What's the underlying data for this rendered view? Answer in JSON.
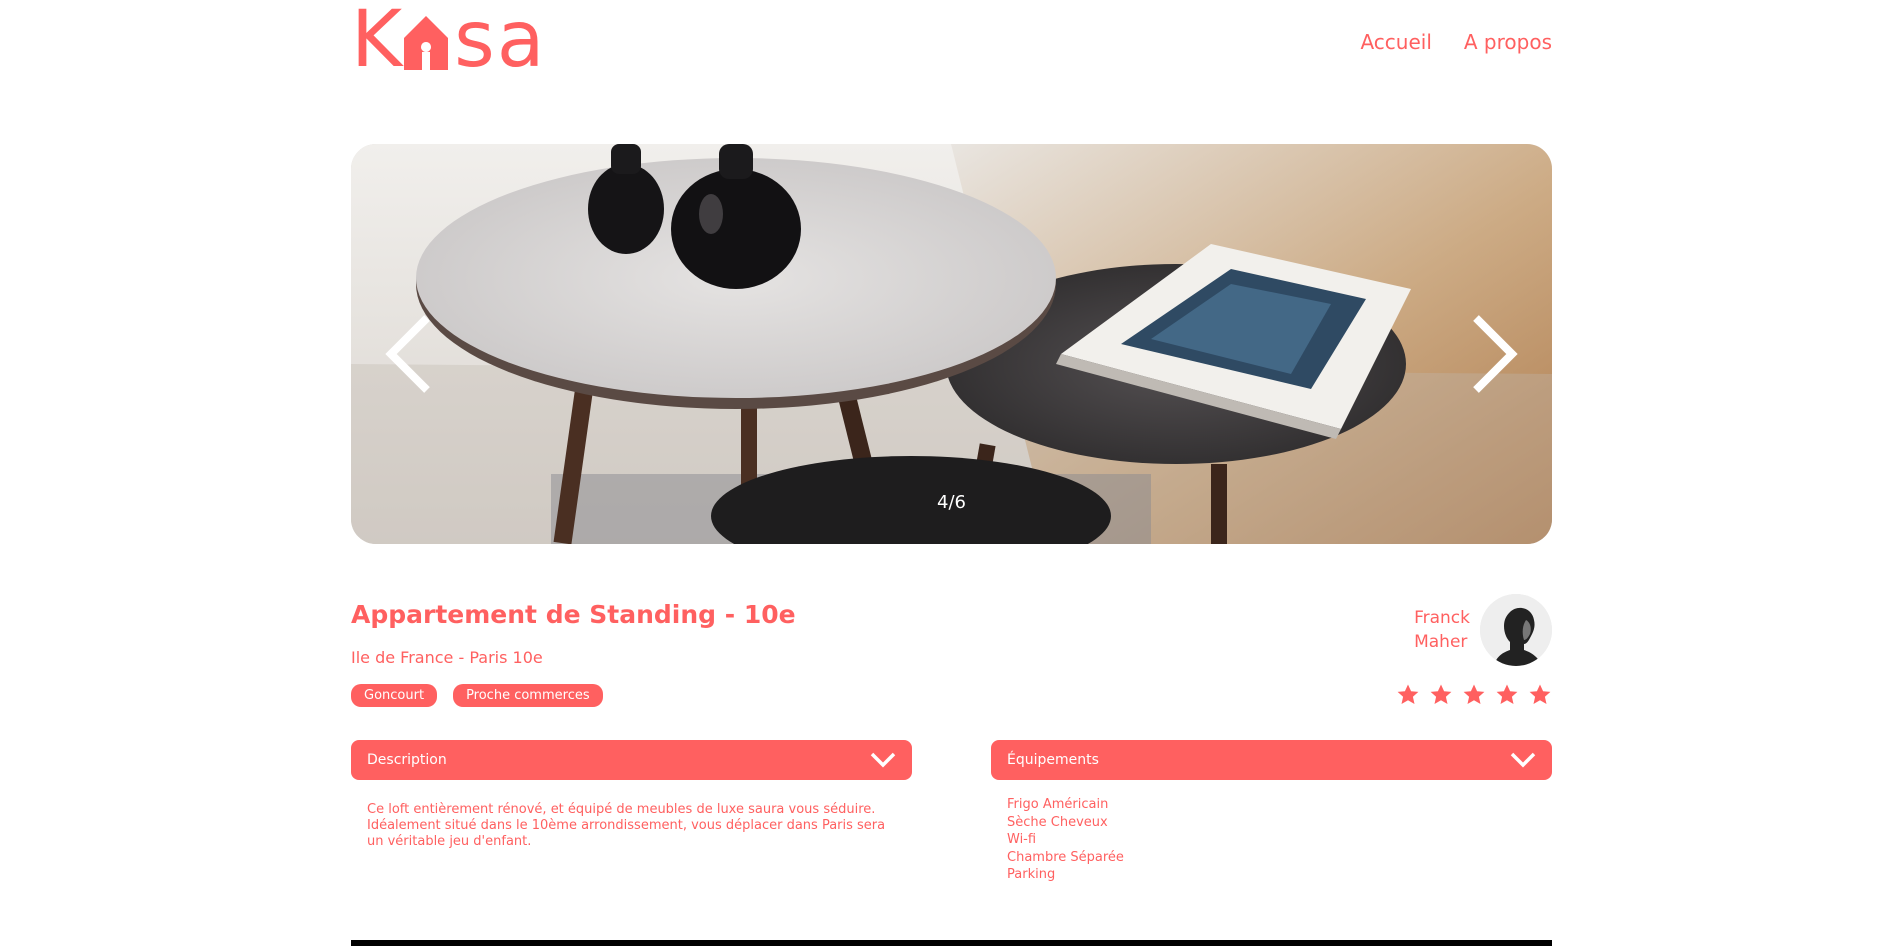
{
  "brand": {
    "logo_left": "K",
    "logo_right": "sa",
    "accent_color": "#FF6060"
  },
  "nav": {
    "items": [
      {
        "label": "Accueil"
      },
      {
        "label": "A propos"
      }
    ]
  },
  "carousel": {
    "counter": "4/6",
    "prev_icon": "chevron-left-icon",
    "next_icon": "chevron-right-icon"
  },
  "listing": {
    "title": "Appartement de Standing - 10e",
    "location": "Ile de France - Paris 10e",
    "tags": [
      "Goncourt",
      "Proche commerces"
    ]
  },
  "host": {
    "first_name": "Franck",
    "last_name": "Maher",
    "rating": 5,
    "rating_max": 5
  },
  "description": {
    "label": "Description",
    "text": "Ce loft entièrement rénové, et équipé de meubles de luxe saura vous séduire. Idéalement situé dans le 10ème arrondissement, vous déplacer dans Paris sera un véritable jeu d'enfant."
  },
  "equipments": {
    "label": "Équipements",
    "items": [
      "Frigo Américain",
      "Sèche Cheveux",
      "Wi-fi",
      "Chambre Séparée",
      "Parking"
    ]
  }
}
